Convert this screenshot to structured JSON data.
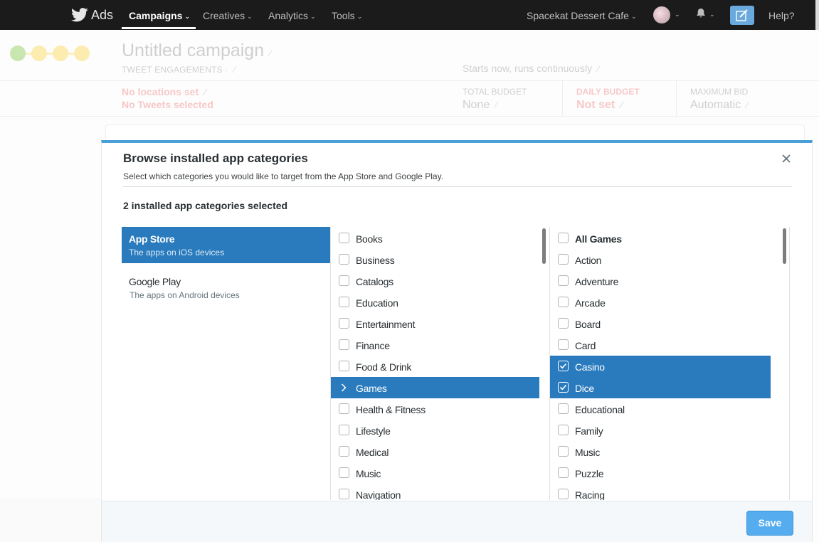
{
  "nav": {
    "brand": "Ads",
    "items": [
      {
        "label": "Campaigns",
        "chevron": "⌄",
        "icon": "chevron-down-icon"
      },
      {
        "label": "Creatives",
        "chevron": "⌄",
        "icon": "chevron-down-icon"
      },
      {
        "label": "Analytics",
        "chevron": "⌄",
        "icon": "chevron-down-icon"
      },
      {
        "label": "Tools",
        "chevron": "⌄",
        "icon": "chevron-down-icon"
      }
    ],
    "account": "Spacekat Dessert Cafe",
    "help": "Help?",
    "icons": [
      "twitter-bird-icon",
      "avatar",
      "bell-icon",
      "compose-icon"
    ],
    "colors": {
      "bar": "#1b1b1b",
      "accent": "#6aa9dd"
    }
  },
  "campaign": {
    "title": "Untitled campaign",
    "objective": "TWEET ENGAGEMENTS ·",
    "schedule": "Starts now, runs continuously",
    "warnings": [
      "No locations set",
      "No Tweets selected"
    ],
    "stats": [
      {
        "label": "TOTAL BUDGET",
        "value": "None"
      },
      {
        "label": "DAILY BUDGET",
        "value": "Not set"
      },
      {
        "label": "MAXIMUM BID",
        "value": "Automatic"
      }
    ],
    "edit_glyph": "⁄"
  },
  "modal": {
    "title": "Browse installed app categories",
    "subtitle": "Select which categories you would like to target from the App Store and Google Play.",
    "selected_count": "2 installed app categories selected",
    "stores": [
      {
        "name": "App Store",
        "description": "The apps on iOS devices",
        "active": true
      },
      {
        "name": "Google Play",
        "description": "The apps on Android devices",
        "active": false
      }
    ],
    "categories": [
      {
        "label": "Books",
        "selected": false
      },
      {
        "label": "Business",
        "selected": false
      },
      {
        "label": "Catalogs",
        "selected": false
      },
      {
        "label": "Education",
        "selected": false
      },
      {
        "label": "Entertainment",
        "selected": false
      },
      {
        "label": "Finance",
        "selected": false
      },
      {
        "label": "Food & Drink",
        "selected": false
      },
      {
        "label": "Games",
        "selected": true
      },
      {
        "label": "Health & Fitness",
        "selected": false
      },
      {
        "label": "Lifestyle",
        "selected": false
      },
      {
        "label": "Medical",
        "selected": false
      },
      {
        "label": "Music",
        "selected": false
      },
      {
        "label": "Navigation",
        "selected": false
      }
    ],
    "subcategories": [
      {
        "label": "All Games",
        "checked": false,
        "bold": true
      },
      {
        "label": "Action",
        "checked": false
      },
      {
        "label": "Adventure",
        "checked": false
      },
      {
        "label": "Arcade",
        "checked": false
      },
      {
        "label": "Board",
        "checked": false
      },
      {
        "label": "Card",
        "checked": false
      },
      {
        "label": "Casino",
        "checked": true
      },
      {
        "label": "Dice",
        "checked": true
      },
      {
        "label": "Educational",
        "checked": false
      },
      {
        "label": "Family",
        "checked": false
      },
      {
        "label": "Music",
        "checked": false
      },
      {
        "label": "Puzzle",
        "checked": false
      },
      {
        "label": "Racing",
        "checked": false
      }
    ],
    "save_label": "Save",
    "close_icon": "close-icon",
    "colors": {
      "accent": "#2a7bbd",
      "top_border": "#4a9fd8",
      "save": "#55acee"
    }
  }
}
